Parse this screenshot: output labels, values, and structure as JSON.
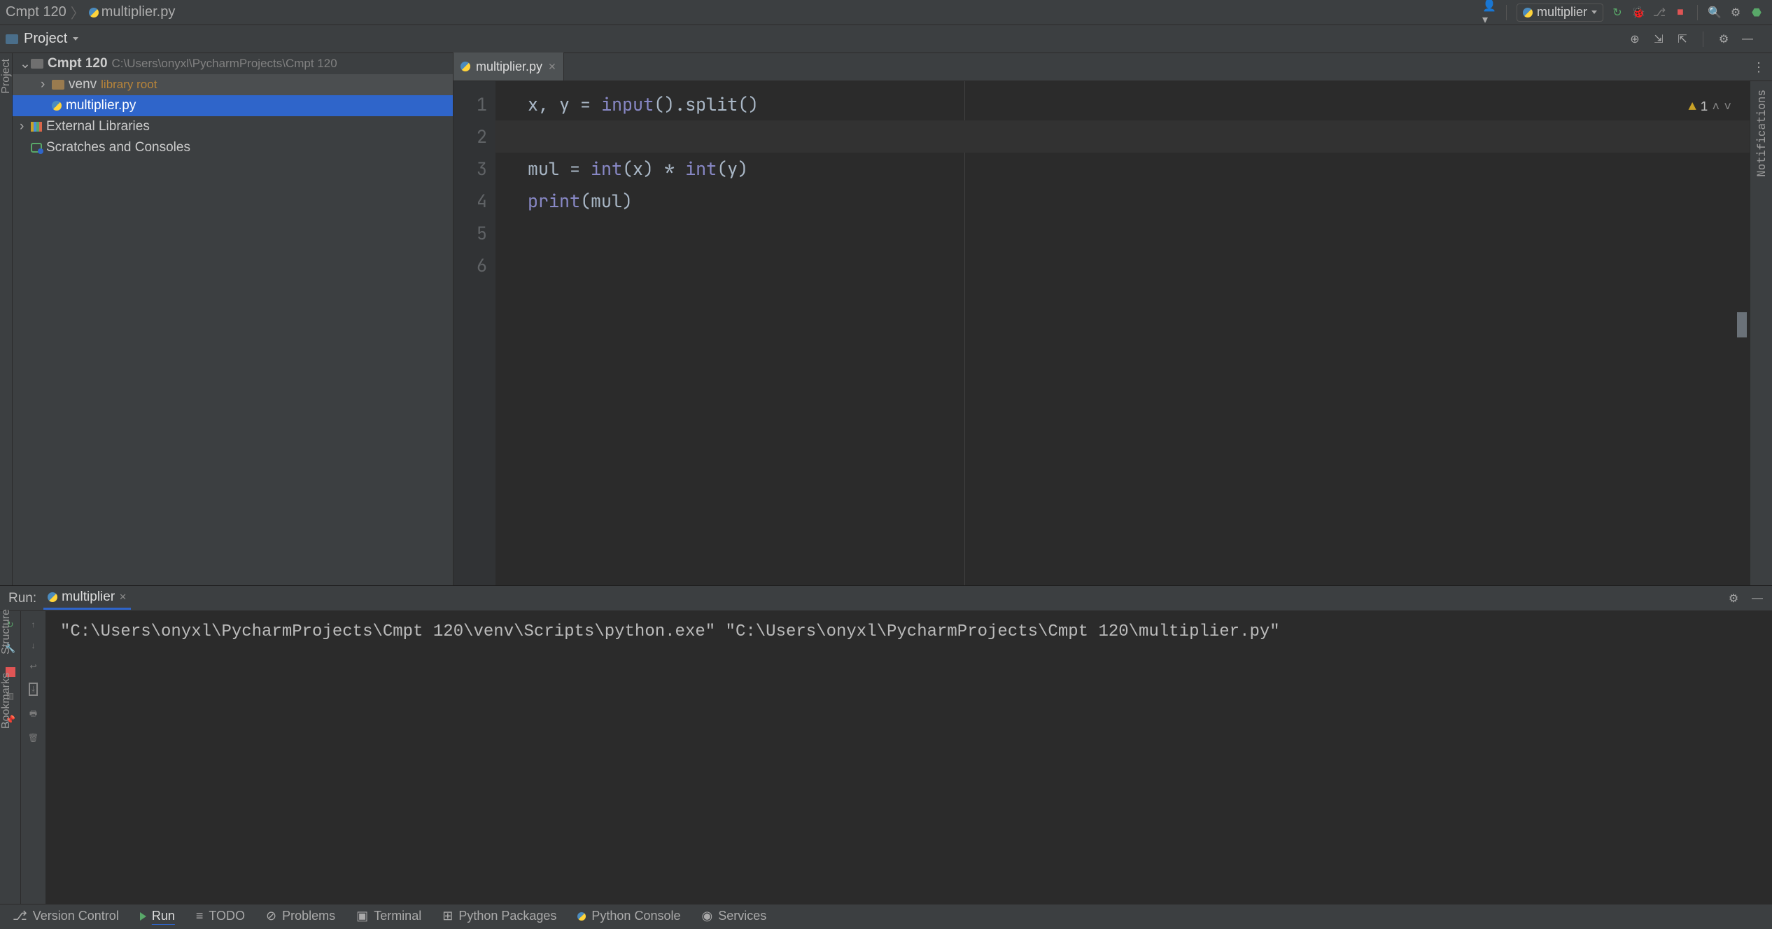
{
  "breadcrumb": {
    "root": "Cmpt 120",
    "file": "multiplier.py"
  },
  "runconfig": {
    "name": "multiplier"
  },
  "project_panel": {
    "title": "Project"
  },
  "tree": {
    "root": {
      "name": "Cmpt 120",
      "path": "C:\\Users\\onyxl\\PycharmProjects\\Cmpt 120"
    },
    "venv": {
      "name": "venv",
      "tag": "library root"
    },
    "file": {
      "name": "multiplier.py"
    },
    "ext_libs": "External Libraries",
    "scratches": "Scratches and Consoles"
  },
  "tabs": {
    "active": "multiplier.py"
  },
  "inspection": {
    "warn_count": "1"
  },
  "code": {
    "l1_a": "x",
    "l1_b": ", ",
    "l1_c": "y ",
    "l1_d": "= ",
    "l1_e": "input",
    "l1_f": "().split()",
    "l3_a": "mul ",
    "l3_b": "= ",
    "l3_c": "int",
    "l3_d": "(x) ",
    "l3_e": "* ",
    "l3_f": "int",
    "l3_g": "(y)",
    "l4_a": "print",
    "l4_b": "(mul)"
  },
  "gutter": [
    "1",
    "2",
    "3",
    "4",
    "5",
    "6"
  ],
  "run": {
    "label": "Run:",
    "tab": "multiplier",
    "output": "\"C:\\Users\\onyxl\\PycharmProjects\\Cmpt 120\\venv\\Scripts\\python.exe\" \"C:\\Users\\onyxl\\PycharmProjects\\Cmpt 120\\multiplier.py\""
  },
  "bottom": {
    "vcs": "Version Control",
    "run": "Run",
    "todo": "TODO",
    "problems": "Problems",
    "terminal": "Terminal",
    "pypkg": "Python Packages",
    "pycon": "Python Console",
    "services": "Services"
  },
  "siderails": {
    "project": "Project",
    "notifications": "Notifications",
    "structure": "Structure",
    "bookmarks": "Bookmarks"
  }
}
